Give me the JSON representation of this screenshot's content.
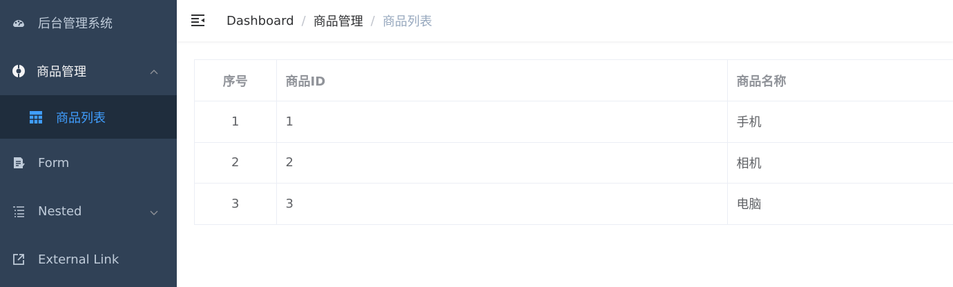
{
  "sidebar": {
    "items": [
      {
        "label": "后台管理系统",
        "icon": "dashboard-icon"
      },
      {
        "label": "商品管理",
        "icon": "target-icon",
        "expanded": true,
        "children": [
          {
            "label": "商品列表",
            "icon": "table-icon",
            "active": true
          }
        ]
      },
      {
        "label": "Form",
        "icon": "form-icon"
      },
      {
        "label": "Nested",
        "icon": "nested-list-icon",
        "expanded": false
      },
      {
        "label": "External Link",
        "icon": "external-link-icon"
      }
    ]
  },
  "navbar": {
    "breadcrumb": [
      "Dashboard",
      "商品管理",
      "商品列表"
    ],
    "separator": "/"
  },
  "table": {
    "headers": [
      "序号",
      "商品ID",
      "商品名称"
    ],
    "rows": [
      {
        "index": "1",
        "id": "1",
        "name": "手机"
      },
      {
        "index": "2",
        "id": "2",
        "name": "相机"
      },
      {
        "index": "3",
        "id": "3",
        "name": "电脑"
      }
    ]
  },
  "colors": {
    "sidebar_bg": "#304156",
    "submenu_bg": "#1f2d3d",
    "accent": "#409eff",
    "sidebar_text": "#bfcbd9"
  }
}
